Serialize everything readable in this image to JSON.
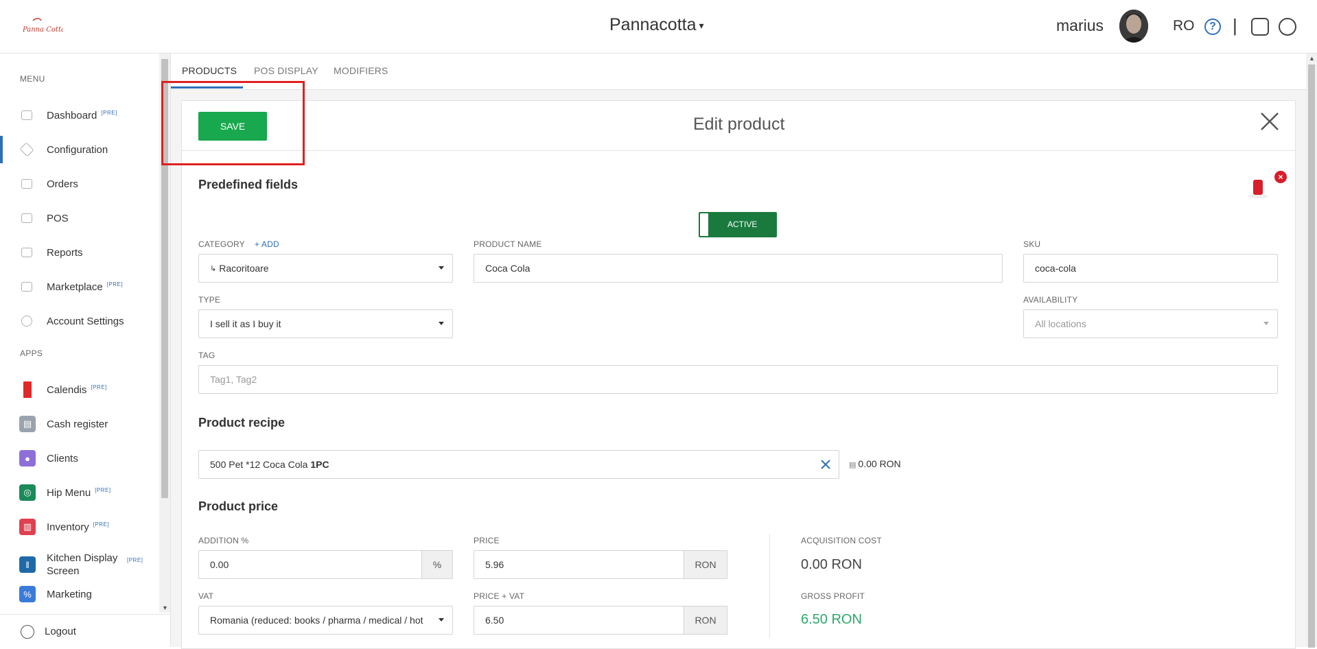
{
  "header": {
    "logo_text": "Panna Cotta",
    "brand": "Pannacotta",
    "user": "marius",
    "language": "RO",
    "help": "?"
  },
  "sidebar": {
    "menu_label": "MENU",
    "apps_label": "APPS",
    "pre_badge": "[PRE]",
    "menu_items": [
      {
        "label": "Dashboard",
        "pre": true,
        "icon": "chart-icon"
      },
      {
        "label": "Configuration",
        "pre": false,
        "icon": "tag-icon"
      },
      {
        "label": "Orders",
        "pre": false,
        "icon": "bag-icon"
      },
      {
        "label": "POS",
        "pre": false,
        "icon": "monitor-icon"
      },
      {
        "label": "Reports",
        "pre": false,
        "icon": "report-icon"
      },
      {
        "label": "Marketplace",
        "pre": true,
        "icon": "cart-icon"
      },
      {
        "label": "Account Settings",
        "pre": false,
        "icon": "gear-icon"
      }
    ],
    "app_items": [
      {
        "label": "Calendis",
        "pre": true,
        "color": "#e02a2a"
      },
      {
        "label": "Cash register",
        "pre": false,
        "color": "#9aa3ad"
      },
      {
        "label": "Clients",
        "pre": false,
        "color": "#8e6fd8"
      },
      {
        "label": "Hip Menu",
        "pre": true,
        "color": "#1a8a5a"
      },
      {
        "label": "Inventory",
        "pre": true,
        "color": "#e04050"
      },
      {
        "label": "Kitchen Display Screen",
        "pre": true,
        "color": "#1e6aa8"
      },
      {
        "label": "Marketing",
        "pre": false,
        "color": "#3a7ad8"
      }
    ],
    "logout": "Logout"
  },
  "tabs": [
    "PRODUCTS",
    "POS DISPLAY",
    "MODIFIERS"
  ],
  "editor": {
    "save_label": "SAVE",
    "title": "Edit product",
    "close": "✕",
    "predefined_title": "Predefined fields",
    "status_label": "ACTIVE",
    "category_label": "CATEGORY",
    "category_add": "+ ADD",
    "category_value": "Racoritoare",
    "product_name_label": "PRODUCT NAME",
    "product_name_value": "Coca Cola",
    "sku_label": "SKU",
    "sku_value": "coca-cola",
    "type_label": "TYPE",
    "type_value": "I sell it as I buy it",
    "availability_label": "AVAILABILITY",
    "availability_placeholder": "All locations",
    "tag_label": "TAG",
    "tag_placeholder": "Tag1, Tag2",
    "recipe_title": "Product recipe",
    "recipe_item": "500 Pet *12 Coca Cola",
    "recipe_qty": "1PC",
    "recipe_cost": "0.00 RON",
    "price_title": "Product price",
    "addition_label": "ADDITION %",
    "addition_value": "0.00",
    "addition_unit": "%",
    "price_label": "PRICE",
    "price_value": "5.96",
    "price_unit": "RON",
    "vat_label": "VAT",
    "vat_value": "Romania (reduced: books / pharma / medical / hot",
    "price_vat_label": "PRICE + VAT",
    "price_vat_value": "6.50",
    "price_vat_unit": "RON",
    "acq_cost_label": "ACQUISITION COST",
    "acq_cost_value": "0.00 RON",
    "gross_profit_label": "GROSS PROFIT",
    "gross_profit_value": "6.50 RON"
  }
}
